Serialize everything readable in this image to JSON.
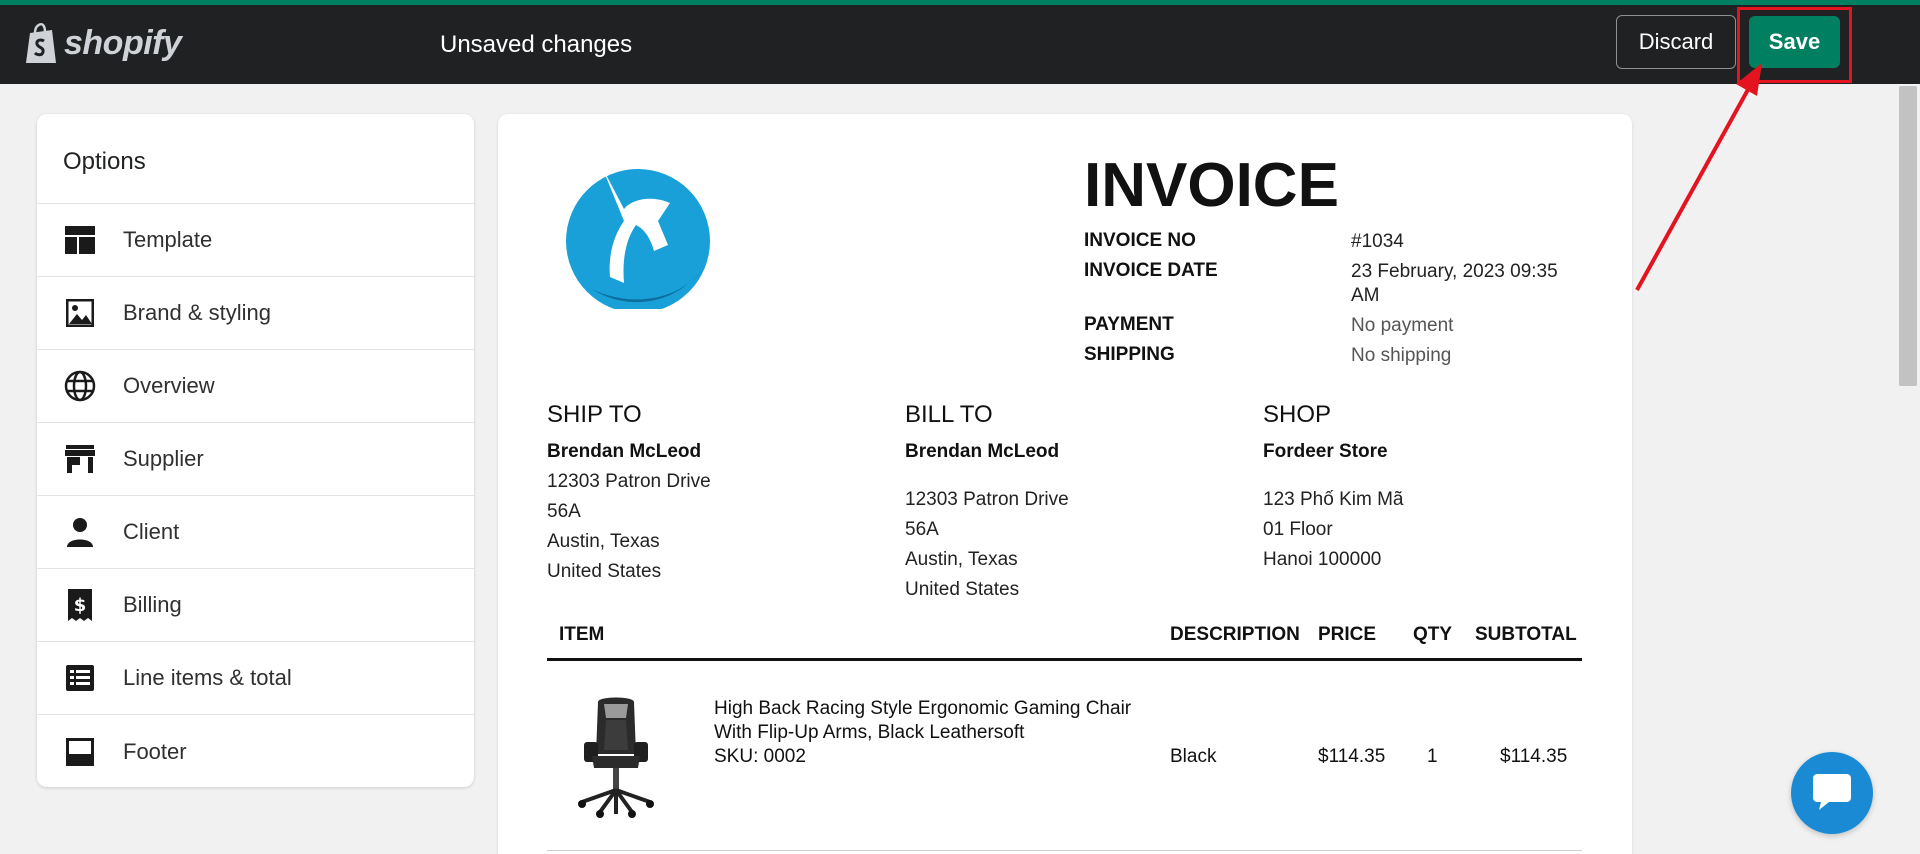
{
  "topbar": {
    "brand": "shopify",
    "title": "Unsaved changes",
    "discard_label": "Discard",
    "save_label": "Save",
    "accent": "#008060",
    "background": "#202123",
    "highlight_color": "#e3141f"
  },
  "sidebar": {
    "title": "Options",
    "items": [
      {
        "label": "Template",
        "icon": "template-icon"
      },
      {
        "label": "Brand & styling",
        "icon": "image-icon"
      },
      {
        "label": "Overview",
        "icon": "globe-icon"
      },
      {
        "label": "Supplier",
        "icon": "store-icon"
      },
      {
        "label": "Client",
        "icon": "person-icon"
      },
      {
        "label": "Billing",
        "icon": "receipt-icon"
      },
      {
        "label": "Line items & total",
        "icon": "list-icon"
      },
      {
        "label": "Footer",
        "icon": "footer-icon"
      }
    ]
  },
  "invoice": {
    "title": "INVOICE",
    "meta": [
      {
        "key": "INVOICE NO",
        "value": "#1034"
      },
      {
        "key": "INVOICE DATE",
        "value": "23 February, 2023 09:35 AM"
      },
      {
        "key": "PAYMENT",
        "value": "No payment"
      },
      {
        "key": "SHIPPING",
        "value": "No shipping"
      }
    ],
    "ship_to": {
      "heading": "SHIP TO",
      "name": "Brendan McLeod",
      "lines": [
        "12303 Patron Drive",
        "56A",
        "Austin, Texas",
        "United States"
      ]
    },
    "bill_to": {
      "heading": "BILL TO",
      "name": "Brendan McLeod",
      "lines": [
        "12303 Patron Drive",
        "56A",
        "Austin, Texas",
        "United States"
      ]
    },
    "shop": {
      "heading": "SHOP",
      "name": "Fordeer Store",
      "lines": [
        "123 Phố Kim Mã",
        "01 Floor",
        "Hanoi 100000"
      ]
    },
    "table": {
      "headers": {
        "item": "ITEM",
        "description": "DESCRIPTION",
        "price": "PRICE",
        "qty": "QTY",
        "subtotal": "SUBTOTAL"
      },
      "rows": [
        {
          "name_line1": "High Back Racing Style Ergonomic Gaming Chair",
          "name_line2": "With Flip-Up Arms, Black Leathersoft",
          "sku": "SKU: 0002",
          "description": "Black",
          "price": "$114.35",
          "qty": "1",
          "subtotal": "$114.35"
        }
      ]
    }
  }
}
